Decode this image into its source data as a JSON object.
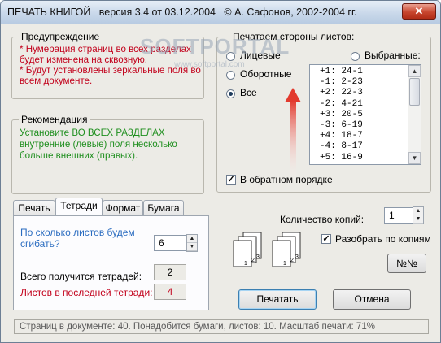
{
  "window": {
    "title": "ПЕЧАТЬ КНИГОЙ   версия 3.4 от 03.12.2004   © А. Сафонов, 2002-2004 гг.",
    "close_label": "✕"
  },
  "warning": {
    "title": "Предупреждение",
    "line1": "* Нумерация страниц во всех разделах",
    "line2": "будет изменена на сквозную.",
    "line3": "* Будут установлены зеркальные поля во",
    "line4": "всем документе."
  },
  "recommendation": {
    "title": "Рекомендация",
    "line1": "Установите ВО ВСЕХ РАЗДЕЛАХ",
    "line2": "внутренние (левые) поля несколько",
    "line3": "больше внешних (правых)."
  },
  "sides": {
    "title": "Печатаем стороны листов:",
    "options": [
      "Лицевые",
      "Оборотные",
      "Все"
    ],
    "selected_option": "Все",
    "selected_label": "Выбранные:",
    "list": [
      "+1: 24-1",
      "-1: 2-23",
      "+2: 22-3",
      "-2: 4-21",
      "+3: 20-5",
      "-3: 6-19",
      "+4: 18-7",
      "-4: 8-17",
      "+5: 16-9"
    ],
    "reverse_label": "В обратном порядке",
    "reverse_checked": true
  },
  "tabs": {
    "items": [
      "Печать",
      "Тетради",
      "Формат",
      "Бумага"
    ],
    "active": "Тетради"
  },
  "notebook": {
    "fold_question_line1": "По сколько листов будем",
    "fold_question_line2": "сгибать?",
    "fold_value": "6",
    "total_label": "Всего получится тетрадей:",
    "total_value": "2",
    "last_label": "Листов в последней тетради:",
    "last_value": "4"
  },
  "copies": {
    "label": "Количество копий:",
    "value": "1",
    "collate_label": "Разобрать по копиям",
    "collate_checked": true,
    "numbers_button": "№№",
    "stack_page_labels": [
      "1",
      "2",
      "3",
      "1",
      "2",
      "3"
    ]
  },
  "buttons": {
    "print": "Печатать",
    "cancel": "Отмена"
  },
  "status": {
    "text": "Страниц в документе: 40. Понадобится бумаги, листов: 10. Масштаб печати: 71%"
  },
  "watermark": {
    "text1": "SOFTPORTAL",
    "text2": "www.softportal.com"
  },
  "colors": {
    "warning_red": "#c2001b",
    "recommend_green": "#1f8f1f",
    "question_blue": "#2a6cc0",
    "arrow_red": "#e23a2e"
  }
}
